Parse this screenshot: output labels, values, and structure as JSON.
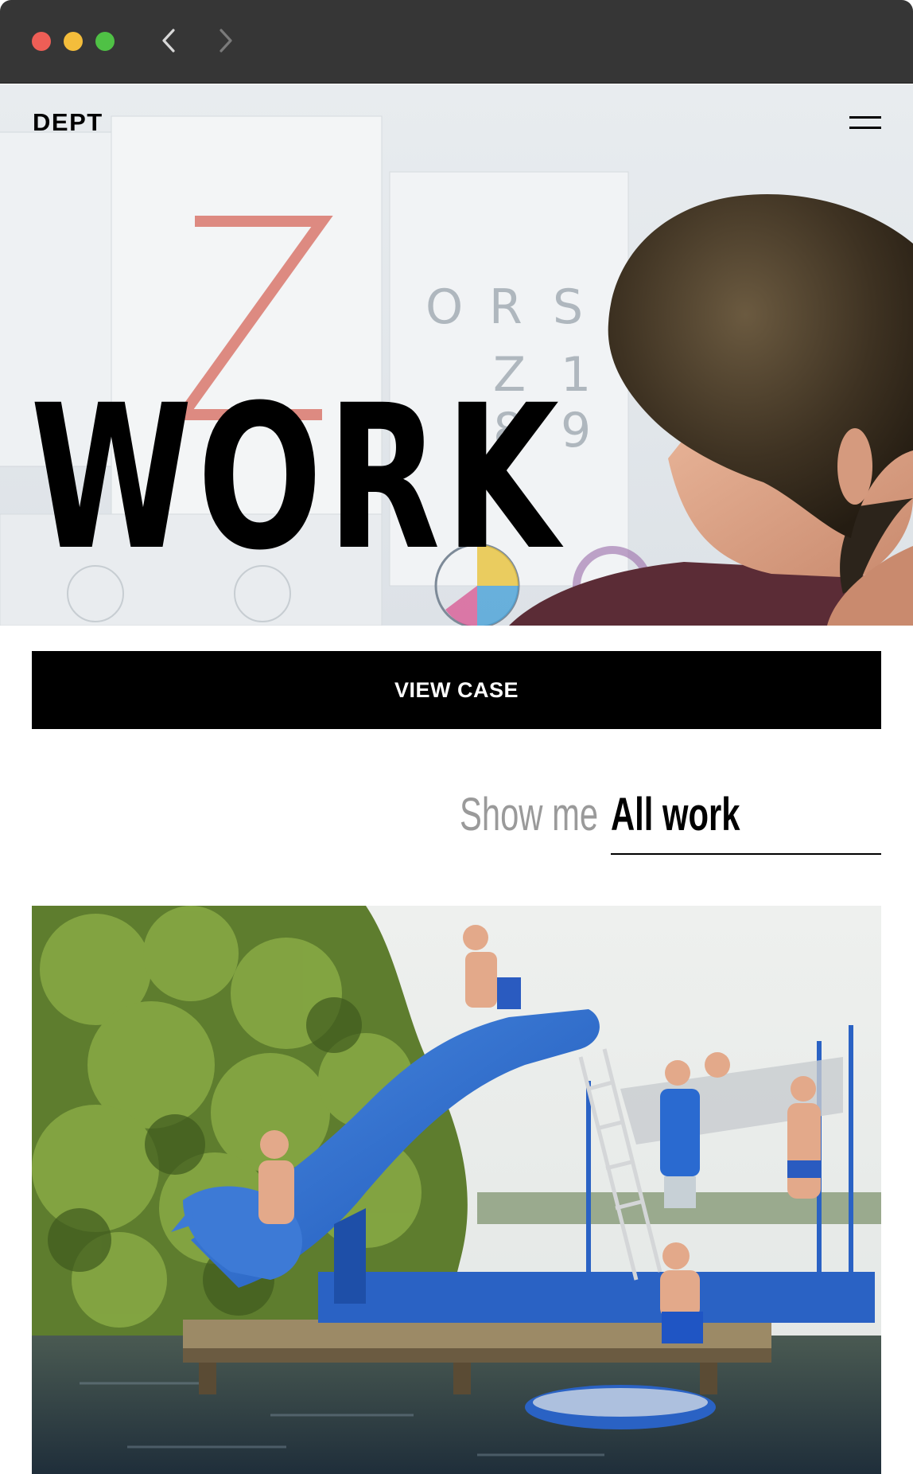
{
  "browser": {
    "back_icon": "chevron-left-icon",
    "forward_icon": "chevron-right-icon",
    "controls": [
      "close",
      "minimize",
      "maximize"
    ]
  },
  "header": {
    "logo": "DEPT",
    "menu_icon": "hamburger-menu-icon"
  },
  "hero": {
    "title": "WORK"
  },
  "cta": {
    "label": "VIEW CASE"
  },
  "filter": {
    "label": "Show me",
    "selected": "All work"
  },
  "colors": {
    "chrome": "#363636",
    "button_bg": "#000000",
    "button_text": "#ffffff",
    "muted_text": "#9a9a9a"
  }
}
